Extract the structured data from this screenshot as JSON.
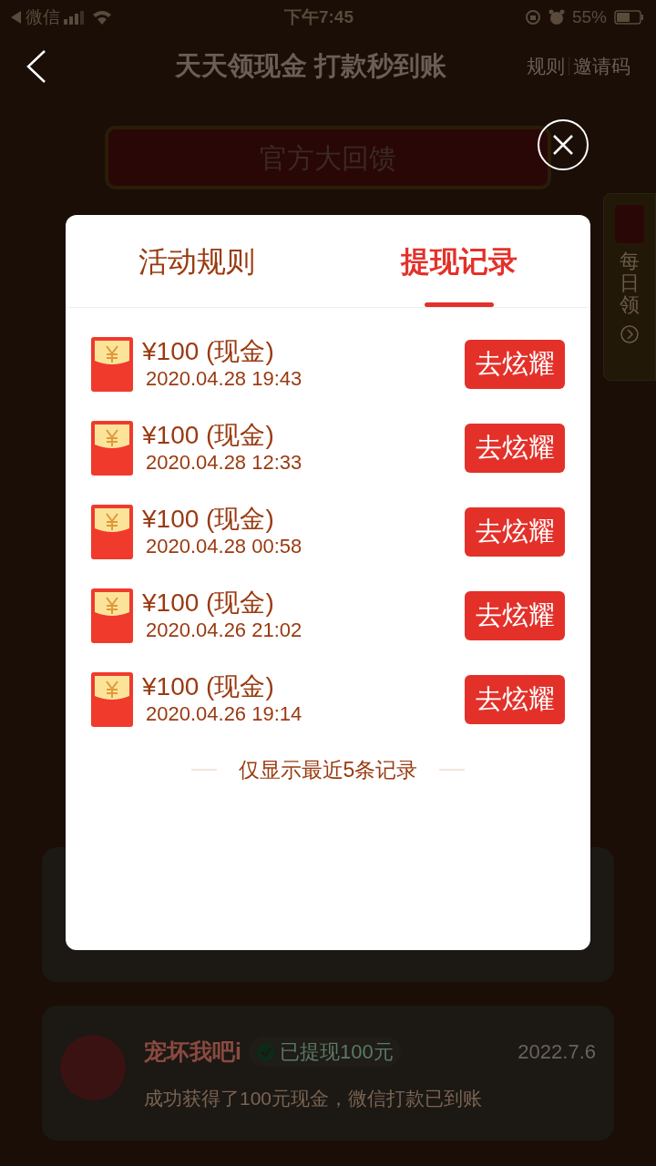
{
  "status_bar": {
    "carrier": "微信",
    "time": "下午7:45",
    "battery": "55%"
  },
  "header": {
    "title": "天天领现金 打款秒到账",
    "links": [
      "规则",
      "邀请码"
    ]
  },
  "banner": {
    "title": "官方大回馈"
  },
  "side_tab": {
    "label": "每日领"
  },
  "feed": [
    {
      "name": "宠坏我吧i",
      "badge": "已提现100元",
      "date": "2022.7.6",
      "message": "成功获得了100元现金，微信打款已到账"
    }
  ],
  "modal": {
    "tabs": [
      {
        "label": "活动规则",
        "selected": false
      },
      {
        "label": "提现记录",
        "selected": true
      }
    ],
    "records": [
      {
        "amount": "¥100 (现金)",
        "time": "2020.04.28 19:43",
        "action": "去炫耀"
      },
      {
        "amount": "¥100 (现金)",
        "time": "2020.04.28 12:33",
        "action": "去炫耀"
      },
      {
        "amount": "¥100 (现金)",
        "time": "2020.04.28 00:58",
        "action": "去炫耀"
      },
      {
        "amount": "¥100 (现金)",
        "time": "2020.04.26 21:02",
        "action": "去炫耀"
      },
      {
        "amount": "¥100 (现金)",
        "time": "2020.04.26 19:14",
        "action": "去炫耀"
      }
    ],
    "note": "仅显示最近5条记录"
  }
}
